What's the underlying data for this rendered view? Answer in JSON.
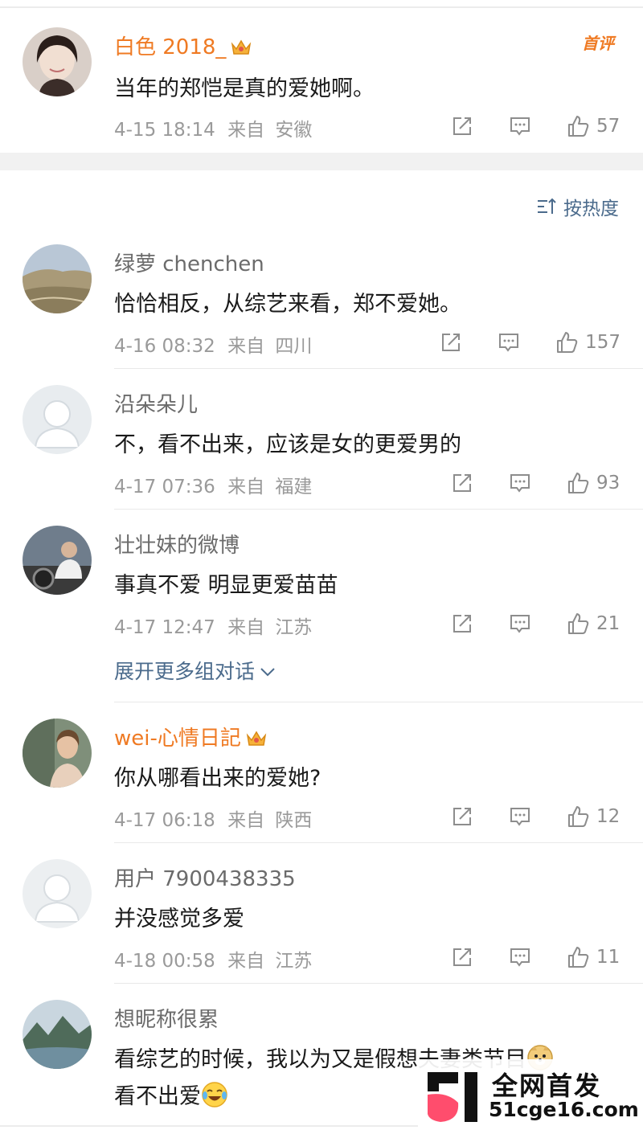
{
  "top_comment": {
    "user": "白色 2018_",
    "text": "当年的郑恺是真的爱她啊。",
    "time": "4-15 18:14",
    "from_label": "来自",
    "location": "安徽",
    "likes": "57",
    "badge": "首评"
  },
  "sort": {
    "label": "按热度"
  },
  "comments": [
    {
      "user": "绿萝 chenchen",
      "text": "恰恰相反，从综艺来看，郑不爱她。",
      "time": "4-16 08:32",
      "from_label": "来自",
      "location": "四川",
      "likes": "157"
    },
    {
      "user": "沿朵朵儿",
      "text": "不，看不出来，应该是女的更爱男的",
      "time": "4-17 07:36",
      "from_label": "来自",
      "location": "福建",
      "likes": "93"
    },
    {
      "user": "壮壮妹的微博",
      "text": "事真不爱  明显更爱苗苗",
      "time": "4-17 12:47",
      "from_label": "来自",
      "location": "江苏",
      "likes": "21"
    },
    {
      "user": "wei-心情日記",
      "text": "你从哪看出来的爱她?",
      "time": "4-17 06:18",
      "from_label": "来自",
      "location": "陕西",
      "likes": "12"
    },
    {
      "user": "用户 7900438335",
      "text": "并没感觉多爱",
      "time": "4-18 00:58",
      "from_label": "来自",
      "location": "江苏",
      "likes": "11"
    },
    {
      "user": "想昵称很累",
      "text": "看综艺的时候，我以为又是假想夫妻类节目",
      "text_line2": "看不出爱"
    }
  ],
  "expand": {
    "label": "展开更多组对话"
  },
  "watermark": {
    "title": "全网首发",
    "url": "51cge16.com"
  },
  "colors": {
    "vip_name": "#ef7a23",
    "link": "#4b6b8c",
    "meta": "#9a9a9a"
  }
}
